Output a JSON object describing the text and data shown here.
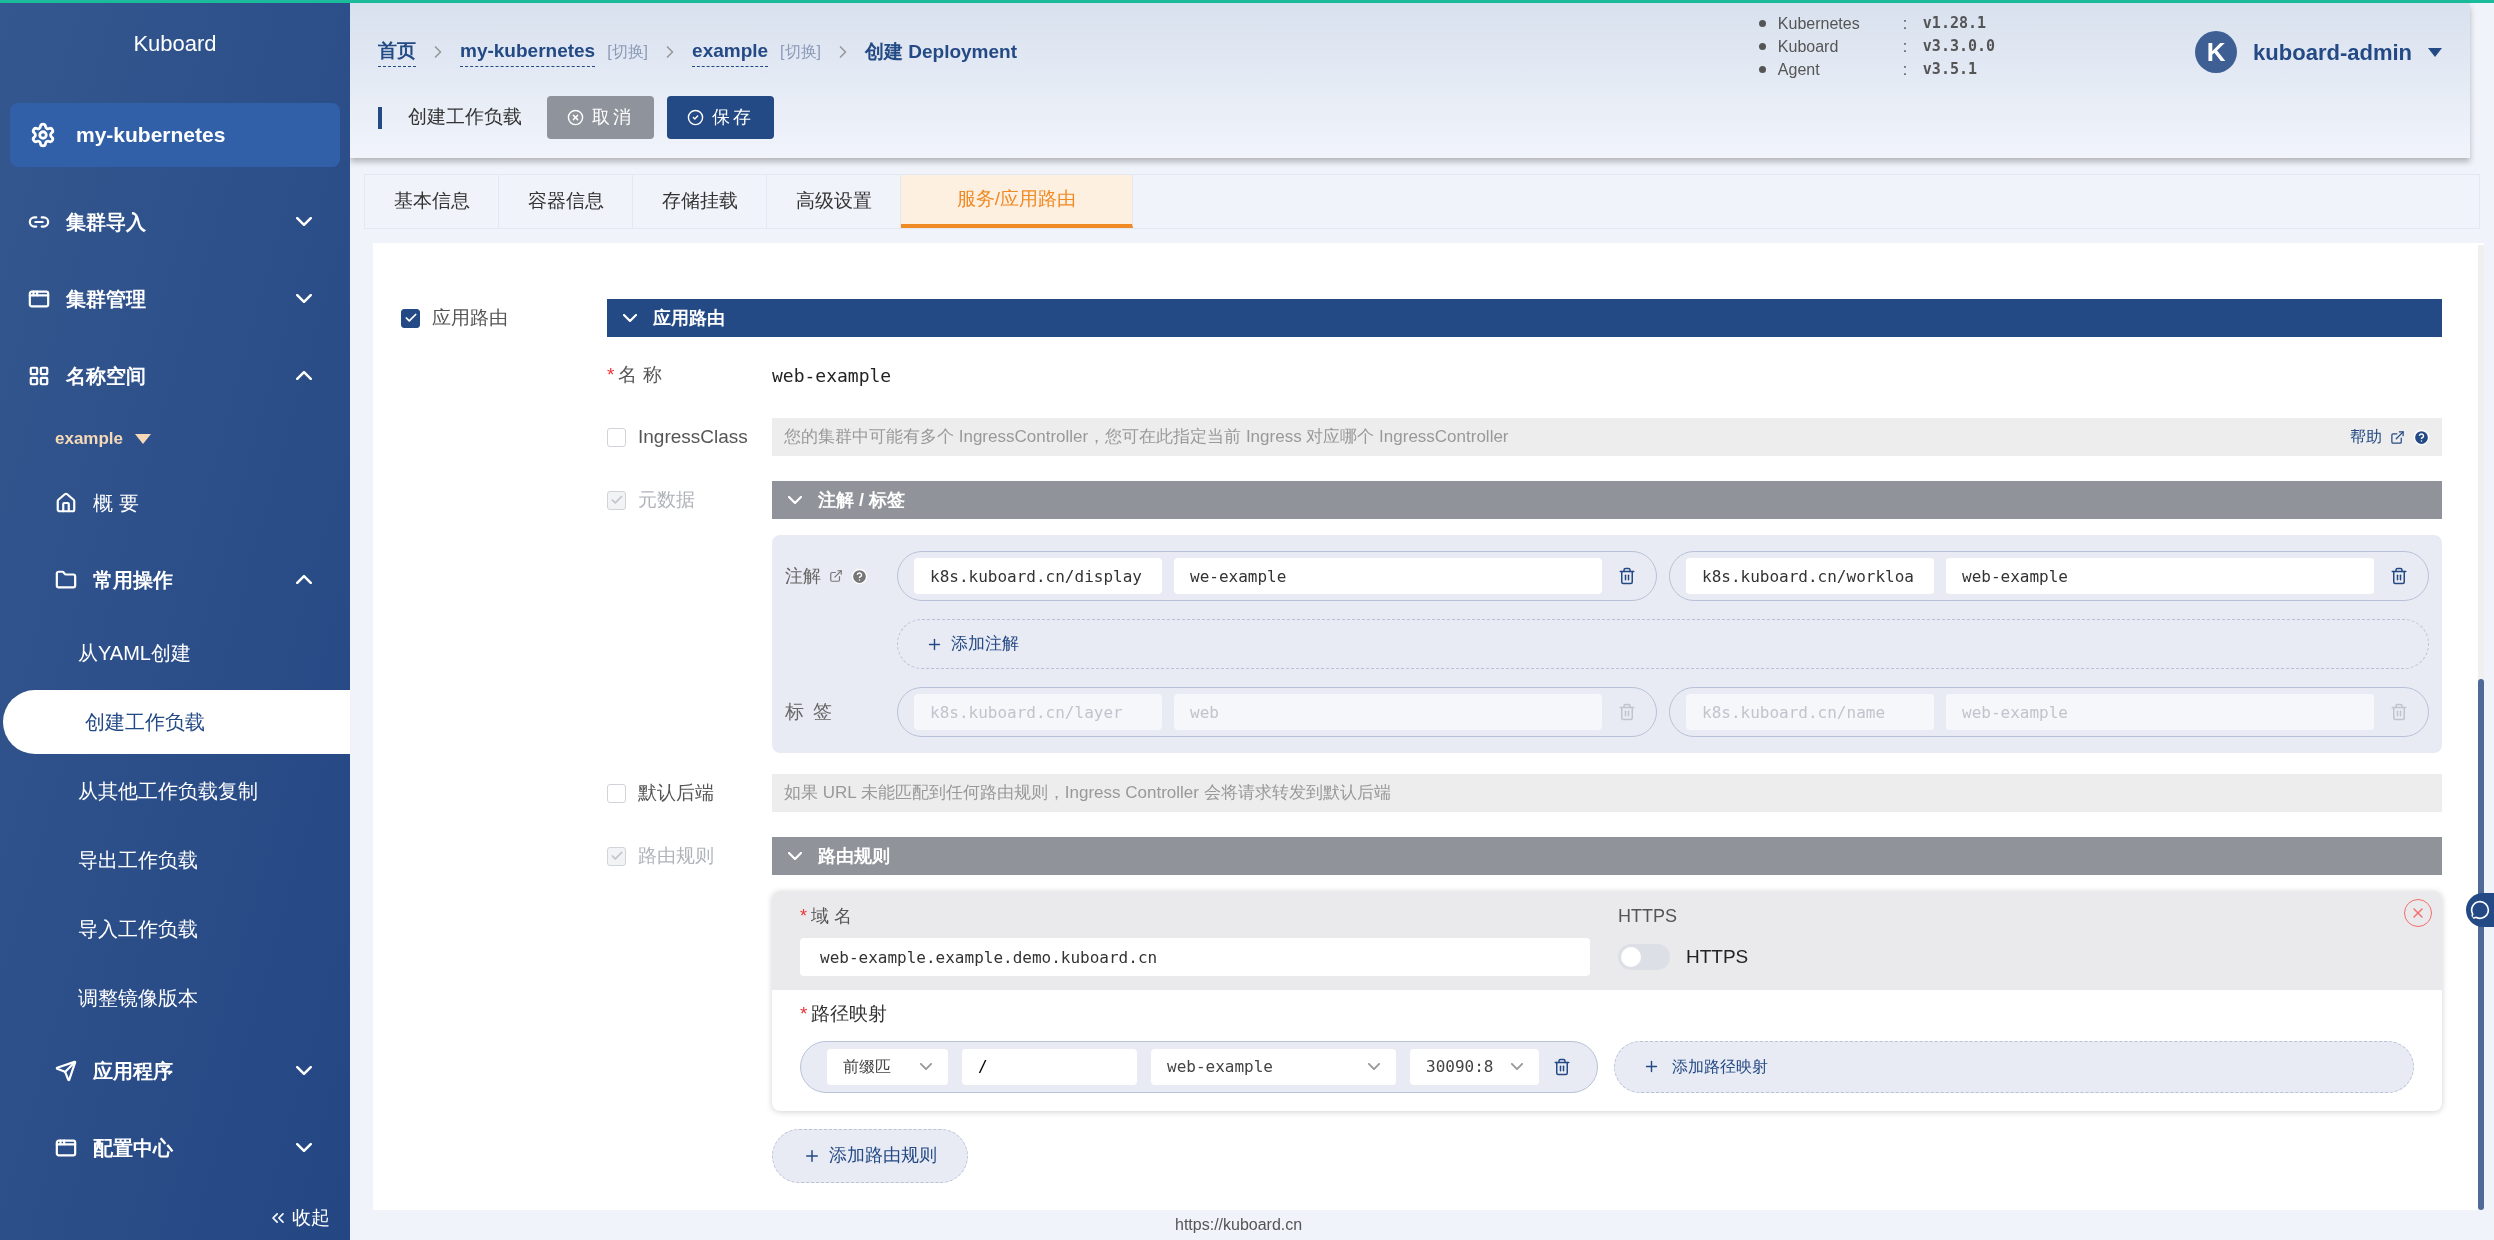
{
  "sidebar": {
    "title": "Kuboard",
    "cluster": "my-kubernetes",
    "items": [
      {
        "kind": "group",
        "label": "集群导入",
        "expanded": false
      },
      {
        "kind": "group",
        "label": "集群管理",
        "expanded": false
      },
      {
        "kind": "group",
        "label": "名称空间",
        "expanded": true,
        "children": [
          {
            "kind": "namespace",
            "label": "example"
          },
          {
            "kind": "link",
            "label": "概 要"
          },
          {
            "kind": "group",
            "label": "常用操作",
            "expanded": true,
            "children": [
              {
                "kind": "page",
                "label": "从YAML创建",
                "selected": false
              },
              {
                "kind": "page",
                "label": "创建工作负载",
                "selected": true
              },
              {
                "kind": "page",
                "label": "从其他工作负载复制",
                "selected": false
              },
              {
                "kind": "page",
                "label": "导出工作负载",
                "selected": false
              },
              {
                "kind": "page",
                "label": "导入工作负载",
                "selected": false
              },
              {
                "kind": "page",
                "label": "调整镜像版本",
                "selected": false
              }
            ]
          },
          {
            "kind": "group",
            "label": "应用程序",
            "expanded": false
          },
          {
            "kind": "group",
            "label": "配置中心",
            "expanded": false
          }
        ]
      }
    ],
    "collapse": "收起"
  },
  "breadcrumb": [
    {
      "label": "首页"
    },
    {
      "label": "my-kubernetes",
      "switch": "[切换]"
    },
    {
      "label": "example",
      "switch": "[切换]"
    },
    {
      "label": "创建 Deployment"
    }
  ],
  "versions": [
    {
      "name": "Kubernetes",
      "sep": ":",
      "value": "v1.28.1"
    },
    {
      "name": "Kuboard",
      "sep": ":",
      "value": "v3.3.0.0"
    },
    {
      "name": "Agent",
      "sep": ":",
      "value": "v3.5.1"
    }
  ],
  "user": {
    "initial": "K",
    "name": "kuboard-admin"
  },
  "toolbar": {
    "title": "创建工作负载",
    "buttons": [
      {
        "kind": "cancel",
        "label": "取消"
      },
      {
        "kind": "save",
        "label": "保存"
      }
    ]
  },
  "tabs": [
    {
      "label": "基本信息",
      "selected": false
    },
    {
      "label": "容器信息",
      "selected": false
    },
    {
      "label": "存储挂载",
      "selected": false
    },
    {
      "label": "高级设置",
      "selected": false
    },
    {
      "label": "服务/应用路由",
      "selected": true
    }
  ],
  "form": {
    "section": {
      "label": "应用路由",
      "checked": true,
      "header": "应用路由"
    },
    "name": {
      "required_mark": "*",
      "label": "名 称",
      "value": "web-example"
    },
    "ingress_class": {
      "label": "IngressClass",
      "checked": false,
      "hint": "您的集群中可能有多个 IngressController，您可在此指定当前 Ingress 对应哪个 IngressController",
      "help": "帮助"
    },
    "metadata": {
      "label": "元数据",
      "checked": true,
      "disabled": true,
      "header": "注解 / 标签",
      "annotations": {
        "label": "注解",
        "disabled": false,
        "pairs": [
          {
            "key": "k8s.kuboard.cn/display",
            "value": "we-example"
          },
          {
            "key": "k8s.kuboard.cn/workloa",
            "value": "web-example"
          }
        ],
        "add": "添加注解"
      },
      "labels": {
        "label": "标 签",
        "disabled": true,
        "pairs": [
          {
            "key": "k8s.kuboard.cn/layer",
            "value": "web"
          },
          {
            "key": "k8s.kuboard.cn/name",
            "value": "web-example"
          }
        ]
      }
    },
    "default_backend": {
      "label": "默认后端",
      "checked": false,
      "hint": "如果 URL 未能匹配到任何路由规则，Ingress Controller 会将请求转发到默认后端"
    },
    "rules": {
      "label": "路由规则",
      "checked": true,
      "disabled": true,
      "header": "路由规则",
      "items": [
        {
          "host_required_mark": "*",
          "host_label": "域 名",
          "host": "web-example.example.demo.kuboard.cn",
          "https_label": "HTTPS",
          "https": {
            "on": false,
            "label": "HTTPS"
          },
          "paths_required_mark": "*",
          "paths_label": "路径映射",
          "paths": [
            {
              "match": "前缀匹",
              "path": "/",
              "service": "web-example",
              "port": "30090:8"
            }
          ],
          "add_path": "添加路径映射"
        }
      ],
      "add_rule": "添加路由规则"
    }
  },
  "footer": "https://kuboard.cn"
}
